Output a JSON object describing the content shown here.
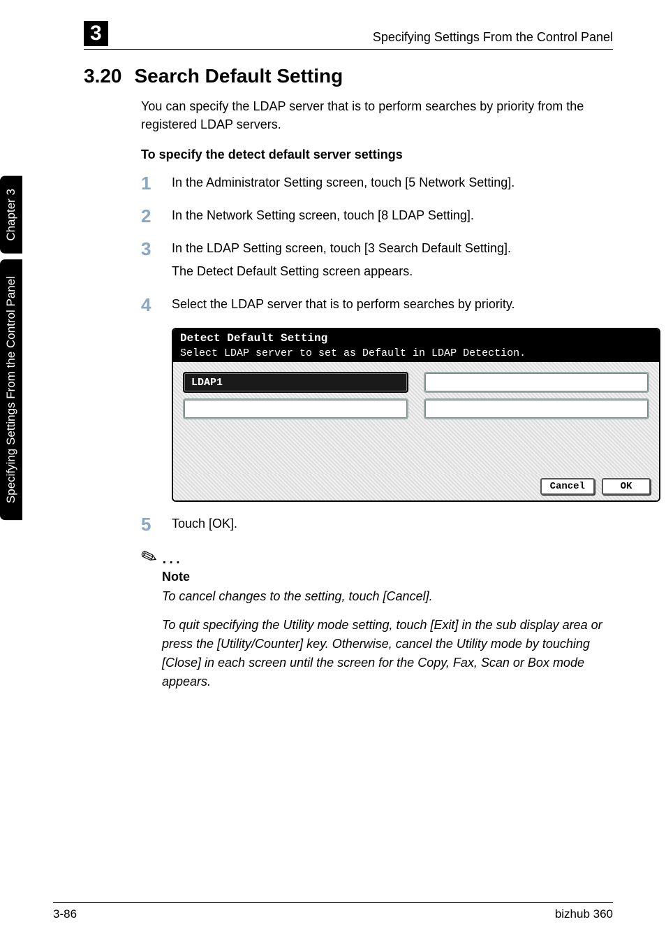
{
  "header": {
    "chapter_number": "3",
    "running_head": "Specifying Settings From the Control Panel"
  },
  "side_tabs": {
    "tab_chapter": "Chapter 3",
    "tab_title": "Specifying Settings From the Control Panel"
  },
  "section": {
    "number": "3.20",
    "title": "Search Default Setting",
    "intro": "You can specify the LDAP server that is to perform searches by priority from the registered LDAP servers.",
    "subhead": "To specify the detect default server settings"
  },
  "steps": {
    "s1": {
      "num": "1",
      "text": "In the Administrator Setting screen, touch [5 Network Setting]."
    },
    "s2": {
      "num": "2",
      "text": "In the Network Setting screen, touch [8 LDAP Setting]."
    },
    "s3": {
      "num": "3",
      "text1": "In the LDAP Setting screen, touch [3 Search Default Setting].",
      "text2": "The Detect Default Setting screen appears."
    },
    "s4": {
      "num": "4",
      "text": "Select the LDAP server that is to perform searches by priority."
    },
    "s5": {
      "num": "5",
      "text": "Touch [OK]."
    }
  },
  "screenshot": {
    "titlebar": "Detect Default Setting",
    "instruction": "Select LDAP server to set as Default in LDAP Detection.",
    "slots": {
      "r1c1": "LDAP1",
      "r1c2": "",
      "r2c1": "",
      "r2c2": ""
    },
    "buttons": {
      "cancel": "Cancel",
      "ok": "OK"
    }
  },
  "note": {
    "icon_dots": "...",
    "label": "Note",
    "p1": "To cancel changes to the setting, touch [Cancel].",
    "p2": "To quit specifying the Utility mode setting, touch [Exit] in the sub display area or press the [Utility/Counter] key. Otherwise, cancel the Utility mode by touching [Close] in each screen until the screen for the Copy, Fax, Scan or Box mode appears."
  },
  "footer": {
    "page": "3-86",
    "product": "bizhub 360"
  }
}
